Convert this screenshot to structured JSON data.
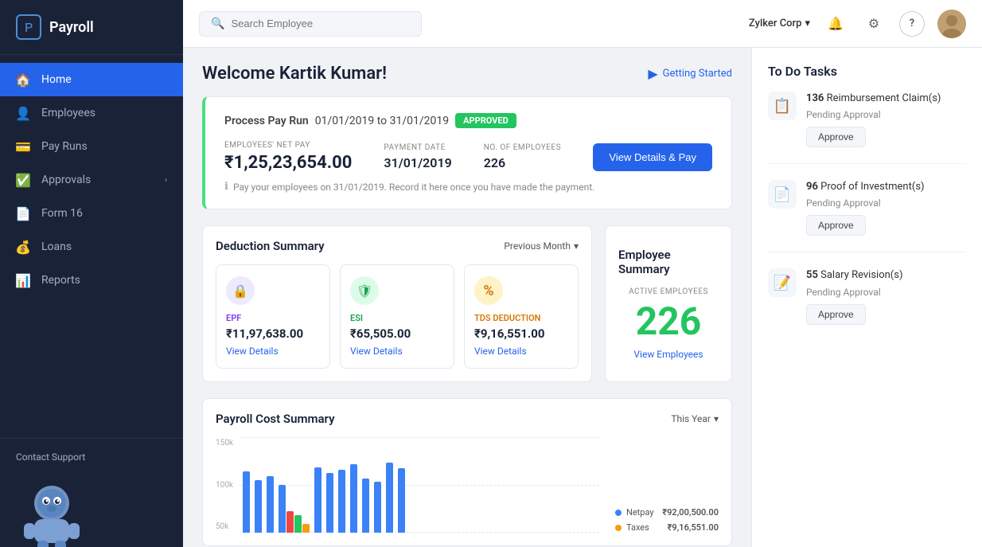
{
  "sidebar": {
    "logo_text": "Payroll",
    "nav_items": [
      {
        "id": "home",
        "label": "Home",
        "icon": "🏠",
        "active": true
      },
      {
        "id": "employees",
        "label": "Employees",
        "icon": "👤",
        "active": false
      },
      {
        "id": "payruns",
        "label": "Pay Runs",
        "icon": "💳",
        "active": false
      },
      {
        "id": "approvals",
        "label": "Approvals",
        "icon": "✅",
        "active": false,
        "arrow": true
      },
      {
        "id": "form16",
        "label": "Form 16",
        "icon": "📄",
        "active": false
      },
      {
        "id": "loans",
        "label": "Loans",
        "icon": "💰",
        "active": false
      },
      {
        "id": "reports",
        "label": "Reports",
        "icon": "📊",
        "active": false
      }
    ],
    "contact_support": "Contact Support"
  },
  "header": {
    "search_placeholder": "Search Employee",
    "company_name": "Zylker Corp",
    "settings_icon": "⚙",
    "help_icon": "?",
    "notification_icon": "🔔"
  },
  "main": {
    "welcome_title": "Welcome Kartik Kumar!",
    "getting_started": "Getting Started",
    "pay_run": {
      "label": "Process Pay Run",
      "date_range": "01/01/2019 to 31/01/2019",
      "status": "APPROVED",
      "employees_net_pay_label": "EMPLOYEES' NET PAY",
      "employees_net_pay_value": "₹1,25,23,654.00",
      "payment_date_label": "PAYMENT DATE",
      "payment_date_value": "31/01/2019",
      "no_of_employees_label": "NO. OF EMPLOYEES",
      "no_of_employees_value": "226",
      "btn_label": "View Details & Pay",
      "note": "Pay your employees on 31/01/2019. Record it here once you have made the payment."
    },
    "deduction_summary": {
      "title": "Deduction Summary",
      "period": "Previous Month",
      "items": [
        {
          "id": "epf",
          "label": "EPF",
          "value": "₹11,97,638.00",
          "icon": "🔒",
          "link": "View Details"
        },
        {
          "id": "esi",
          "label": "ESI",
          "value": "₹65,505.00",
          "icon": "🛡",
          "link": "View Details"
        },
        {
          "id": "tds",
          "label": "TDS DEDUCTION",
          "value": "₹9,16,551.00",
          "icon": "%",
          "link": "View Details"
        }
      ]
    },
    "employee_summary": {
      "title": "Employee Summary",
      "active_label": "ACTIVE EMPLOYEES",
      "count": "226",
      "link": "View Employees"
    },
    "payroll_cost": {
      "title": "Payroll Cost Summary",
      "period": "This Year",
      "y_labels": [
        "150k",
        "100k",
        "50k"
      ],
      "legend": [
        {
          "label": "Netpay",
          "color": "#3b82f6",
          "value": "₹92,00,500.00"
        },
        {
          "label": "Taxes",
          "color": "#f59e0b",
          "value": "₹9,16,551.00"
        }
      ],
      "bars": [
        {
          "blue": 70,
          "red": 0,
          "green": 0
        },
        {
          "blue": 65,
          "red": 0,
          "green": 0
        },
        {
          "blue": 60,
          "red": 0,
          "green": 0
        },
        {
          "blue": 55,
          "red": 25,
          "green": 20,
          "yellow": 10
        },
        {
          "blue": 75,
          "red": 0,
          "green": 0
        },
        {
          "blue": 68,
          "red": 0,
          "green": 0
        },
        {
          "blue": 72,
          "red": 0,
          "green": 0
        },
        {
          "blue": 78,
          "red": 0,
          "green": 0
        },
        {
          "blue": 62,
          "red": 0,
          "green": 0
        },
        {
          "blue": 58,
          "red": 0,
          "green": 0
        },
        {
          "blue": 80,
          "red": 0,
          "green": 0
        },
        {
          "blue": 74,
          "red": 0,
          "green": 0
        }
      ]
    }
  },
  "todo": {
    "title": "To Do Tasks",
    "items": [
      {
        "count": "136",
        "label": "Reimbursement Claim(s)",
        "sublabel": "Pending Approval",
        "btn": "Approve",
        "icon": "📋"
      },
      {
        "count": "96",
        "label": "Proof of Investment(s)",
        "sublabel": "Pending Approval",
        "btn": "Approve",
        "icon": "📄"
      },
      {
        "count": "55",
        "label": "Salary Revision(s)",
        "sublabel": "Pending Approval",
        "btn": "Approve",
        "icon": "📝"
      }
    ]
  }
}
